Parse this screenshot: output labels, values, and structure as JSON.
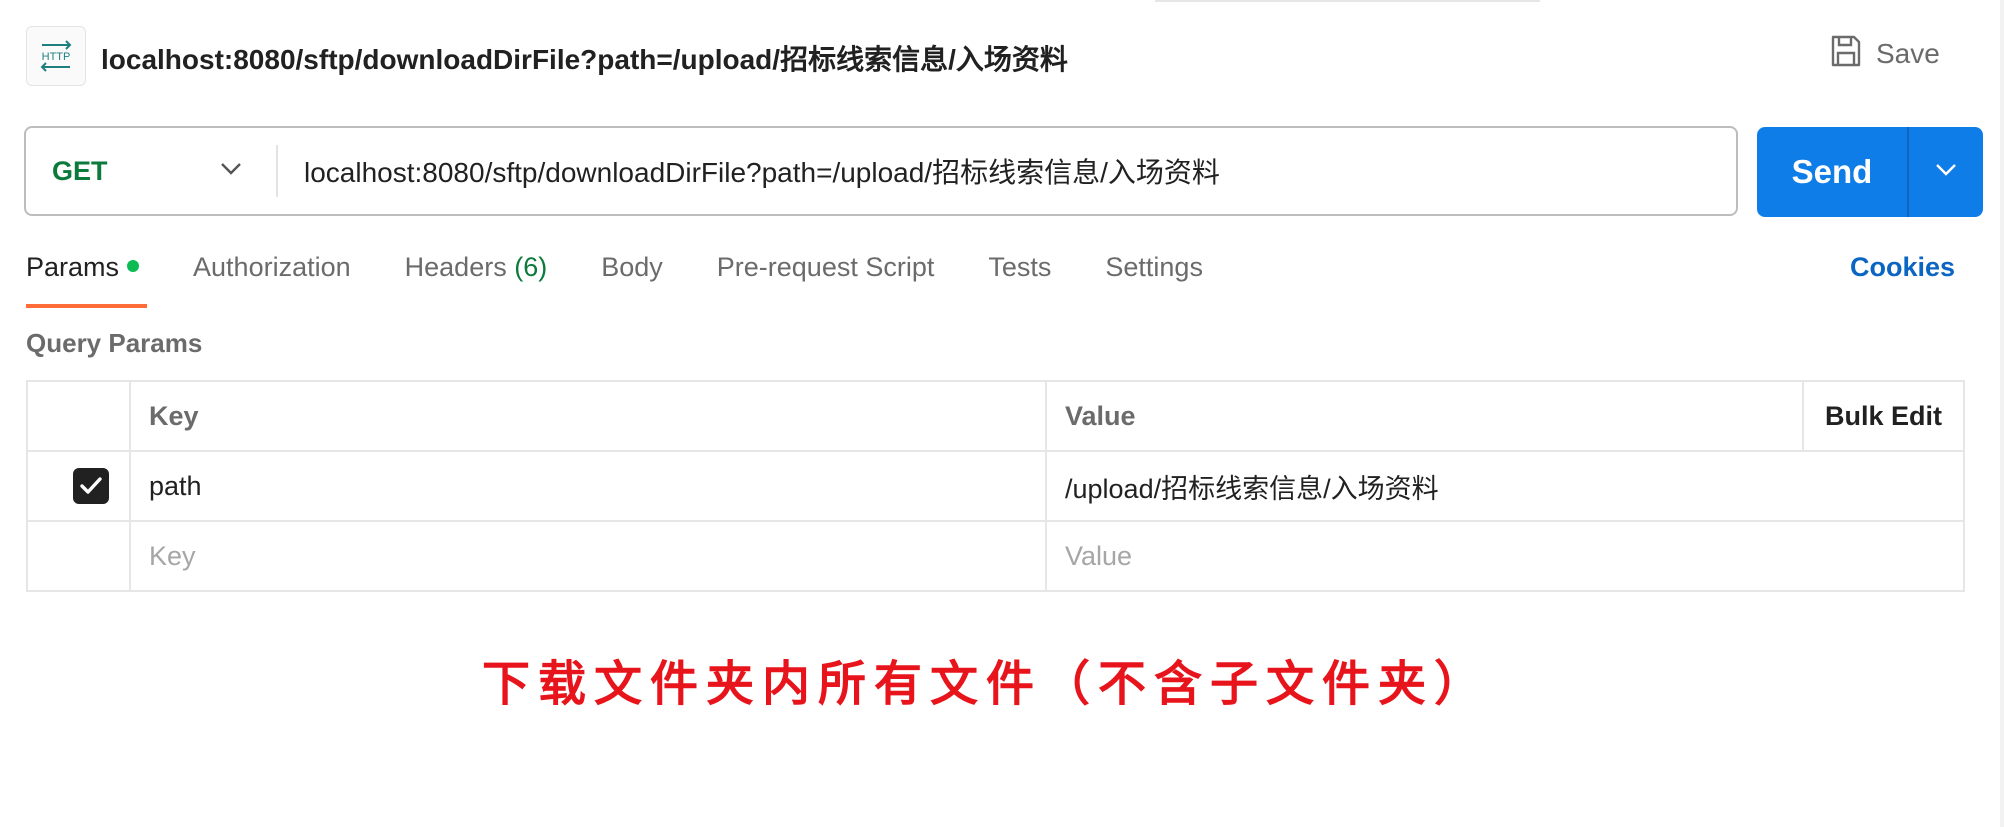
{
  "header": {
    "badge_text": "HTTP",
    "title": "localhost:8080/sftp/downloadDirFile?path=/upload/招标线索信息/入场资料",
    "save_label": "Save"
  },
  "request": {
    "method": "GET",
    "url": "localhost:8080/sftp/downloadDirFile?path=/upload/招标线索信息/入场资料",
    "send_label": "Send"
  },
  "tabs": [
    {
      "label": "Params",
      "active": true
    },
    {
      "label": "Authorization"
    },
    {
      "label": "Headers",
      "count": "(6)"
    },
    {
      "label": "Body"
    },
    {
      "label": "Pre-request Script"
    },
    {
      "label": "Tests"
    },
    {
      "label": "Settings"
    }
  ],
  "cookies_label": "Cookies",
  "query_params": {
    "title": "Query Params",
    "headers": {
      "key": "Key",
      "value": "Value",
      "bulk": "Bulk Edit"
    },
    "rows": [
      {
        "checked": true,
        "key": "path",
        "value": "/upload/招标线索信息/入场资料"
      }
    ],
    "placeholder": {
      "key": "Key",
      "value": "Value"
    }
  },
  "annotation": "下载文件夹内所有文件（不含子文件夹）",
  "colors": {
    "accent_send": "#0f7de8",
    "method_get": "#0b7a3b",
    "tab_underline": "#ff6c37",
    "annotation": "#e8141c"
  },
  "icons": {
    "badge": "http-icon",
    "save": "save-icon",
    "method_dropdown": "chevron-down-icon",
    "send_dropdown": "chevron-down-icon",
    "checkbox": "check-icon"
  }
}
